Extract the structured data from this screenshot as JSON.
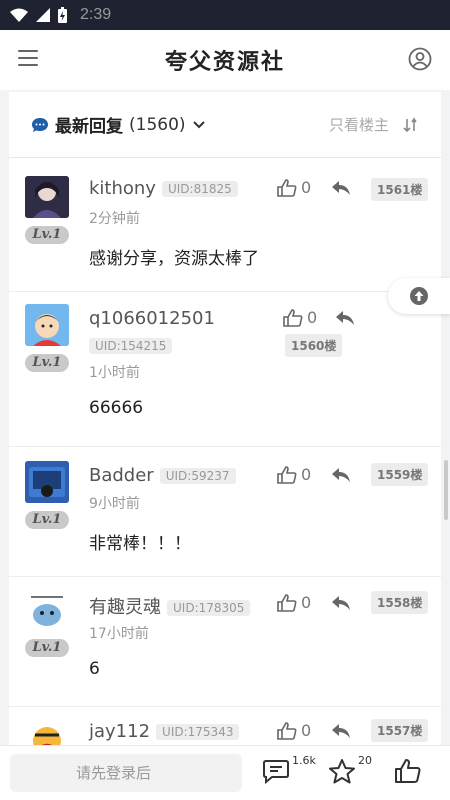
{
  "status": {
    "time": "2:39"
  },
  "app": {
    "title": "夸父资源社"
  },
  "section": {
    "label": "最新回复",
    "count": "(1560)",
    "filter": "只看楼主"
  },
  "comments": [
    {
      "name": "kithony",
      "uid": "UID:81825",
      "time": "2分钟前",
      "text": "感谢分享，资源太棒了",
      "likes": "0",
      "floor": "1561楼",
      "level": "Lv.1"
    },
    {
      "name": "q1066012501",
      "uid": "UID:154215",
      "time": "1小时前",
      "text": "66666",
      "likes": "0",
      "floor": "1560楼",
      "level": "Lv.1"
    },
    {
      "name": "Badder",
      "uid": "UID:59237",
      "time": "9小时前",
      "text": "非常棒！！！",
      "likes": "0",
      "floor": "1559楼",
      "level": "Lv.1"
    },
    {
      "name": "有趣灵魂",
      "uid": "UID:178305",
      "time": "17小时前",
      "text": "6",
      "likes": "0",
      "floor": "1558楼",
      "level": "Lv.1"
    },
    {
      "name": "jay112",
      "uid": "UID:175343",
      "time": "",
      "text": "",
      "likes": "0",
      "floor": "1557楼",
      "level": ""
    }
  ],
  "bottom": {
    "placeholder": "请先登录后",
    "comment_count": "1.6k",
    "star_count": "20"
  },
  "colors": {
    "accent": "#1e5fa8"
  }
}
